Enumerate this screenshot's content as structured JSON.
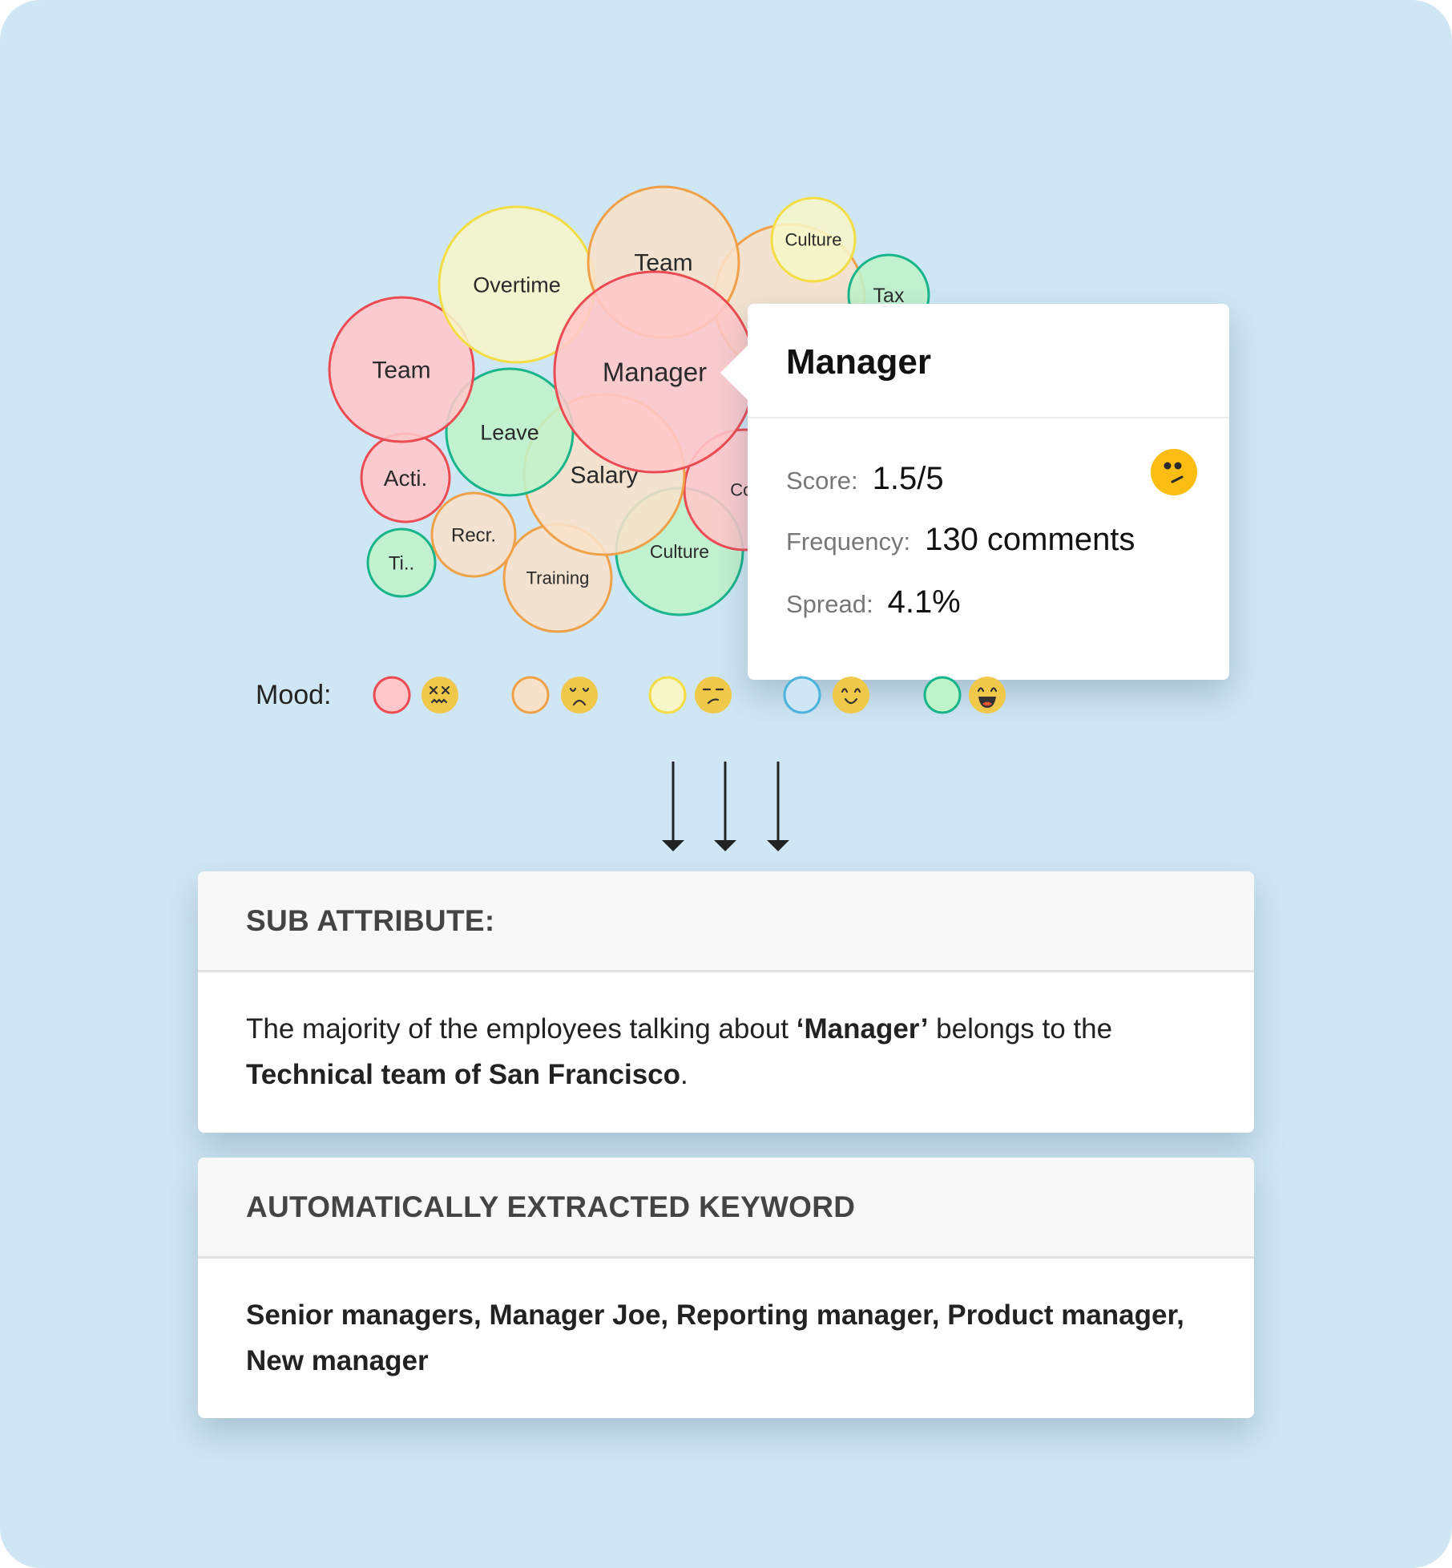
{
  "bubbles": [
    {
      "label": "Culture",
      "mood": "very_positive"
    },
    {
      "label": "Training",
      "mood": "negative"
    },
    {
      "label": "Ti..",
      "mood": "very_positive"
    },
    {
      "label": "Recr.",
      "mood": "negative"
    },
    {
      "label": "Acti.",
      "mood": "very_negative"
    },
    {
      "label": "Cor",
      "mood": "very_negative"
    },
    {
      "label": "Salary",
      "mood": "negative"
    },
    {
      "label": "Leave",
      "mood": "very_positive"
    },
    {
      "label": "Team",
      "mood": "very_negative"
    },
    {
      "label": "",
      "mood": "negative"
    },
    {
      "label": "Tax",
      "mood": "very_positive"
    },
    {
      "label": "Overtime",
      "mood": "neutral"
    },
    {
      "label": "Team",
      "mood": "negative"
    },
    {
      "label": "Culture",
      "mood": "neutral"
    },
    {
      "label": "Manager",
      "mood": "very_negative"
    }
  ],
  "mood_colors": {
    "very_negative": {
      "fill": "#ffc7c9",
      "stroke": "#ec4b52"
    },
    "negative": {
      "fill": "#f8e1c9",
      "stroke": "#f0a047"
    },
    "neutral": {
      "fill": "#f6f6c8",
      "stroke": "#f4dc45"
    },
    "positive": {
      "fill": "#cfe6f4",
      "stroke": "#4cb3dd"
    },
    "very_positive": {
      "fill": "#bff3c9",
      "stroke": "#18b48a"
    }
  },
  "tooltip": {
    "title": "Manager",
    "score_label": "Score:",
    "score_value": "1.5/5",
    "frequency_label": "Frequency:",
    "frequency_value": "130 comments",
    "spread_label": "Spread:",
    "spread_value": "4.1%",
    "emoji": "confused-face-icon"
  },
  "legend": {
    "label": "Mood:",
    "items": [
      {
        "mood": "very_negative",
        "emoji": "dizzy-face-icon"
      },
      {
        "mood": "negative",
        "emoji": "frowning-face-icon"
      },
      {
        "mood": "neutral",
        "emoji": "unamused-face-icon"
      },
      {
        "mood": "positive",
        "emoji": "smiling-face-icon"
      },
      {
        "mood": "very_positive",
        "emoji": "grinning-face-icon"
      }
    ]
  },
  "sub_attribute": {
    "header": "SUB ATTRIBUTE:",
    "text_1": "The majority of the employees talking about ",
    "text_2": "‘Manager’",
    "text_3": " belongs to the ",
    "text_4": "Technical team of San Francisco",
    "text_5": "."
  },
  "keywords": {
    "header": "AUTOMATICALLY EXTRACTED KEYWORD",
    "text": "Senior managers, Manager Joe, Reporting manager, Product manager, New manager"
  }
}
